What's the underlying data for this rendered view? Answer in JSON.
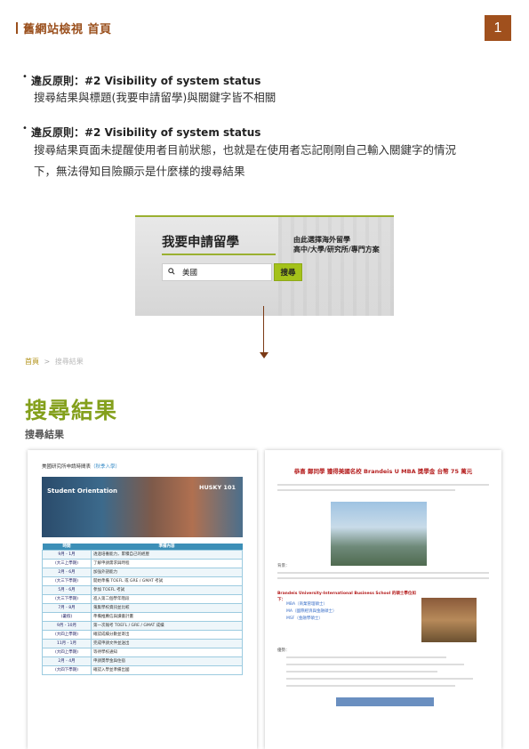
{
  "header": {
    "title": "舊網站檢視 首頁",
    "page_number": "1"
  },
  "bullets": [
    {
      "label": "違反原則：#2 Visibility of system status",
      "lines": [
        "搜尋結果與標題(我要申請留學)與關鍵字皆不相關"
      ]
    },
    {
      "label": "違反原則：#2 Visibility of system status",
      "lines": [
        "搜尋結果頁面未提醒使用者目前狀態，也就是在使用者忘記剛剛自己輸入關鍵字的情況",
        "下，無法得知目險顯示是什麼樣的搜尋結果"
      ]
    }
  ],
  "banner": {
    "heading": "我要申請留學",
    "sub_line1": "由此選擇海外留學",
    "sub_line2": "高中/大學/研究所/專門方案",
    "search_value": "美國",
    "search_button": "搜尋",
    "icon": "search-icon"
  },
  "breadcrumb": {
    "home": "首頁",
    "separator": ">",
    "current": "搜尋結果"
  },
  "results": {
    "title": "搜尋結果",
    "subtitle": "搜尋結果"
  },
  "card1": {
    "title": "美國研究所申請時間表",
    "tag": "（秋季入學）",
    "photo_text": "Student Orientation",
    "photo_logo": "HUSKY 101",
    "table_headers": [
      "時間",
      "準備內容"
    ],
    "rows": [
      {
        "month": "9月 - 1月",
        "text": "透過培養能力，累積自己的經歷"
      },
      {
        "month": "(大三上學期)",
        "text": "了解申請需求與時程"
      },
      {
        "month": "2月 - 6月",
        "text": "加強外語能力"
      },
      {
        "month": "(大三下學期)",
        "text": "開始準備 TOEFL 或 GRE / GMAT 考試"
      },
      {
        "month": "5月 - 6月",
        "text": "參加 TOEFL 考試"
      },
      {
        "month": "(大三下學期)",
        "text": "進入第二個學年階段"
      },
      {
        "month": "7月 - 8月",
        "text": "蒐集學校資訊並比較"
      },
      {
        "month": "(暑假)",
        "text": "準備推薦信與讀書計畫"
      },
      {
        "month": "9月 - 10月",
        "text": "第一次報考 TOEFL / GRE / GMAT 成績"
      },
      {
        "month": "(大四上學期)",
        "text": "確認成績分數並寄出"
      },
      {
        "month": "11月 - 1月",
        "text": "完成申請文件並送出"
      },
      {
        "month": "(大四上學期)",
        "text": "等待學校通知"
      },
      {
        "month": "2月 - 4月",
        "text": "申請獎學金與住宿"
      },
      {
        "month": "(大四下學期)",
        "text": "確認入學並準備出國"
      }
    ]
  },
  "card2": {
    "title": "恭喜 鄭同學 獲得美國名校 Brandeis U MBA 獎學金 台幣 75 萬元",
    "section1": "背景：",
    "line1": "Brandeis University-International Business School 的碩士學位如下：",
    "programs": [
      "MBA（商業管理碩士）",
      "MA（國際經濟與金融碩士）",
      "MSF（金融學碩士）"
    ],
    "section2": "優勢："
  }
}
